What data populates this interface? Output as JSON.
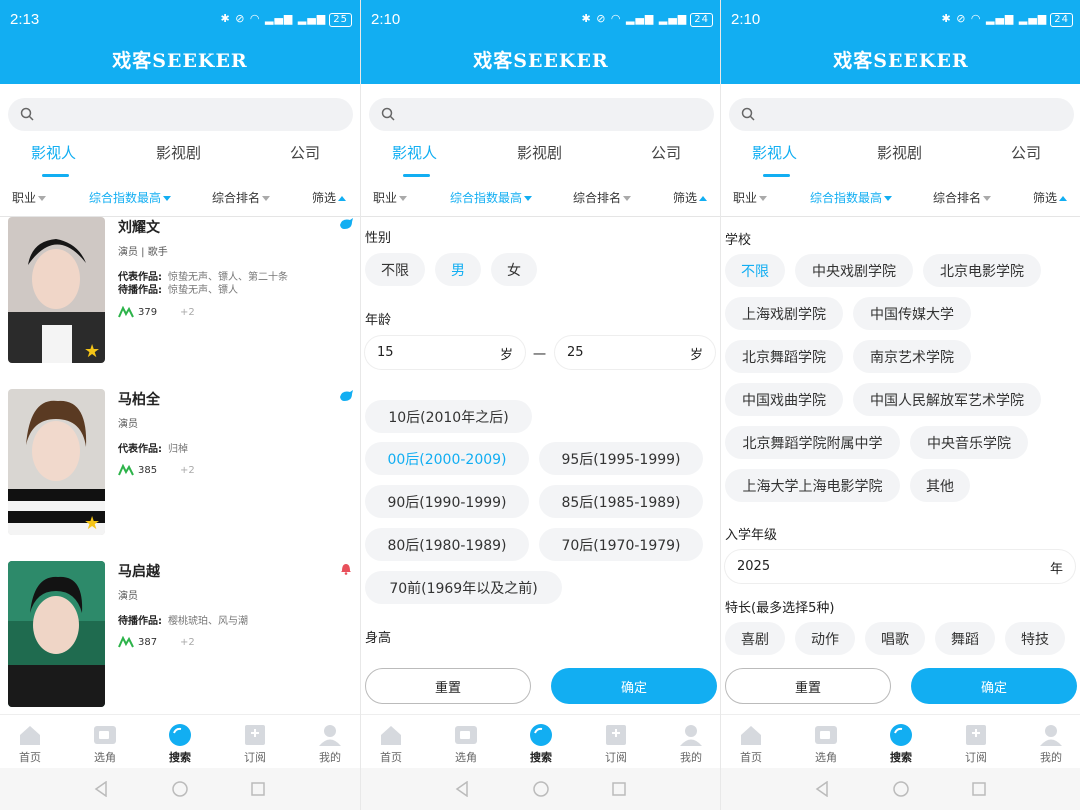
{
  "colors": {
    "accent": "#12aef2",
    "chip_bg": "#f3f4f6",
    "spark": "#2db34a",
    "star": "#f5c518"
  },
  "app_title": "戏客SEEKER",
  "screens": [
    {
      "time": "2:13",
      "battery": "25"
    },
    {
      "time": "2:10",
      "battery": "24"
    },
    {
      "time": "2:10",
      "battery": "24"
    }
  ],
  "tabs": [
    "影视人",
    "影视剧",
    "公司"
  ],
  "filters": [
    "职业",
    "综合指数最高",
    "综合排名",
    "筛选"
  ],
  "actors": [
    {
      "name": "刘耀文",
      "role": "演员 | 歌手",
      "works_label": "代表作品:",
      "works": "惊蛰无声、镖人、第二十条",
      "upcoming_label": "待播作品:",
      "upcoming": "惊蛰无声、镖人",
      "score": "379",
      "plus": "+2"
    },
    {
      "name": "马柏全",
      "role": "演员",
      "works_label": "代表作品:",
      "works": "归棹",
      "score": "385",
      "plus": "+2"
    },
    {
      "name": "马启越",
      "role": "演员",
      "upcoming_label": "待播作品:",
      "upcoming": "樱桃琥珀、风与潮",
      "score": "387",
      "plus": "+2"
    }
  ],
  "panel2": {
    "gender_title": "性别",
    "gender_options": [
      "不限",
      "男",
      "女"
    ],
    "gender_selected": "男",
    "age_title": "年龄",
    "age_from": "15",
    "age_to": "25",
    "age_unit": "岁",
    "age_dash": "一",
    "decades": [
      "10后(2010年之后)",
      "00后(2000-2009)",
      "95后(1995-1999)",
      "90后(1990-1999)",
      "85后(1985-1989)",
      "80后(1980-1989)",
      "70后(1970-1979)",
      "70前(1969年以及之前)"
    ],
    "decade_selected": "00后(2000-2009)",
    "height_title": "身高"
  },
  "panel3": {
    "school_title": "学校",
    "schools": [
      "不限",
      "中央戏剧学院",
      "北京电影学院",
      "上海戏剧学院",
      "中国传媒大学",
      "北京舞蹈学院",
      "南京艺术学院",
      "中国戏曲学院",
      "中国人民解放军艺术学院",
      "北京舞蹈学院附属中学",
      "中央音乐学院",
      "上海大学上海电影学院",
      "其他"
    ],
    "school_selected": "不限",
    "grade_title": "入学年级",
    "grade_value": "2025",
    "grade_unit": "年",
    "skill_title": "特长(最多选择5种)",
    "skills": [
      "喜剧",
      "动作",
      "唱歌",
      "舞蹈",
      "特技"
    ]
  },
  "buttons": {
    "reset": "重置",
    "confirm": "确定"
  },
  "bottom_nav": [
    "首页",
    "选角",
    "搜索",
    "订阅",
    "我的"
  ],
  "bottom_nav_active": "搜索"
}
